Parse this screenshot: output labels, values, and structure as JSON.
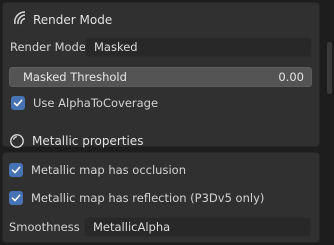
{
  "render_panel": {
    "title": "Render Mode",
    "icon": "render-mode-icon",
    "render_mode_label": "Render Mode:",
    "render_mode_value": "Masked",
    "masked_threshold_label": "Masked Threshold",
    "masked_threshold_value": "0.00",
    "alpha_to_coverage_label": "Use AlphaToCoverage",
    "alpha_to_coverage_checked": true
  },
  "metallic_panel": {
    "title": "Metallic properties",
    "icon": "metallic-sphere-icon",
    "occlusion_label": "Metallic map has occlusion",
    "occlusion_checked": true,
    "reflection_label": "Metallic map has reflection (P3Dv5 only)",
    "reflection_checked": true,
    "smoothness_label": "Smoothness ...",
    "smoothness_value": "MetallicAlpha"
  },
  "colors": {
    "accent": "#4772b3",
    "panel_bg": "#303030",
    "background": "#1d1d1d"
  }
}
